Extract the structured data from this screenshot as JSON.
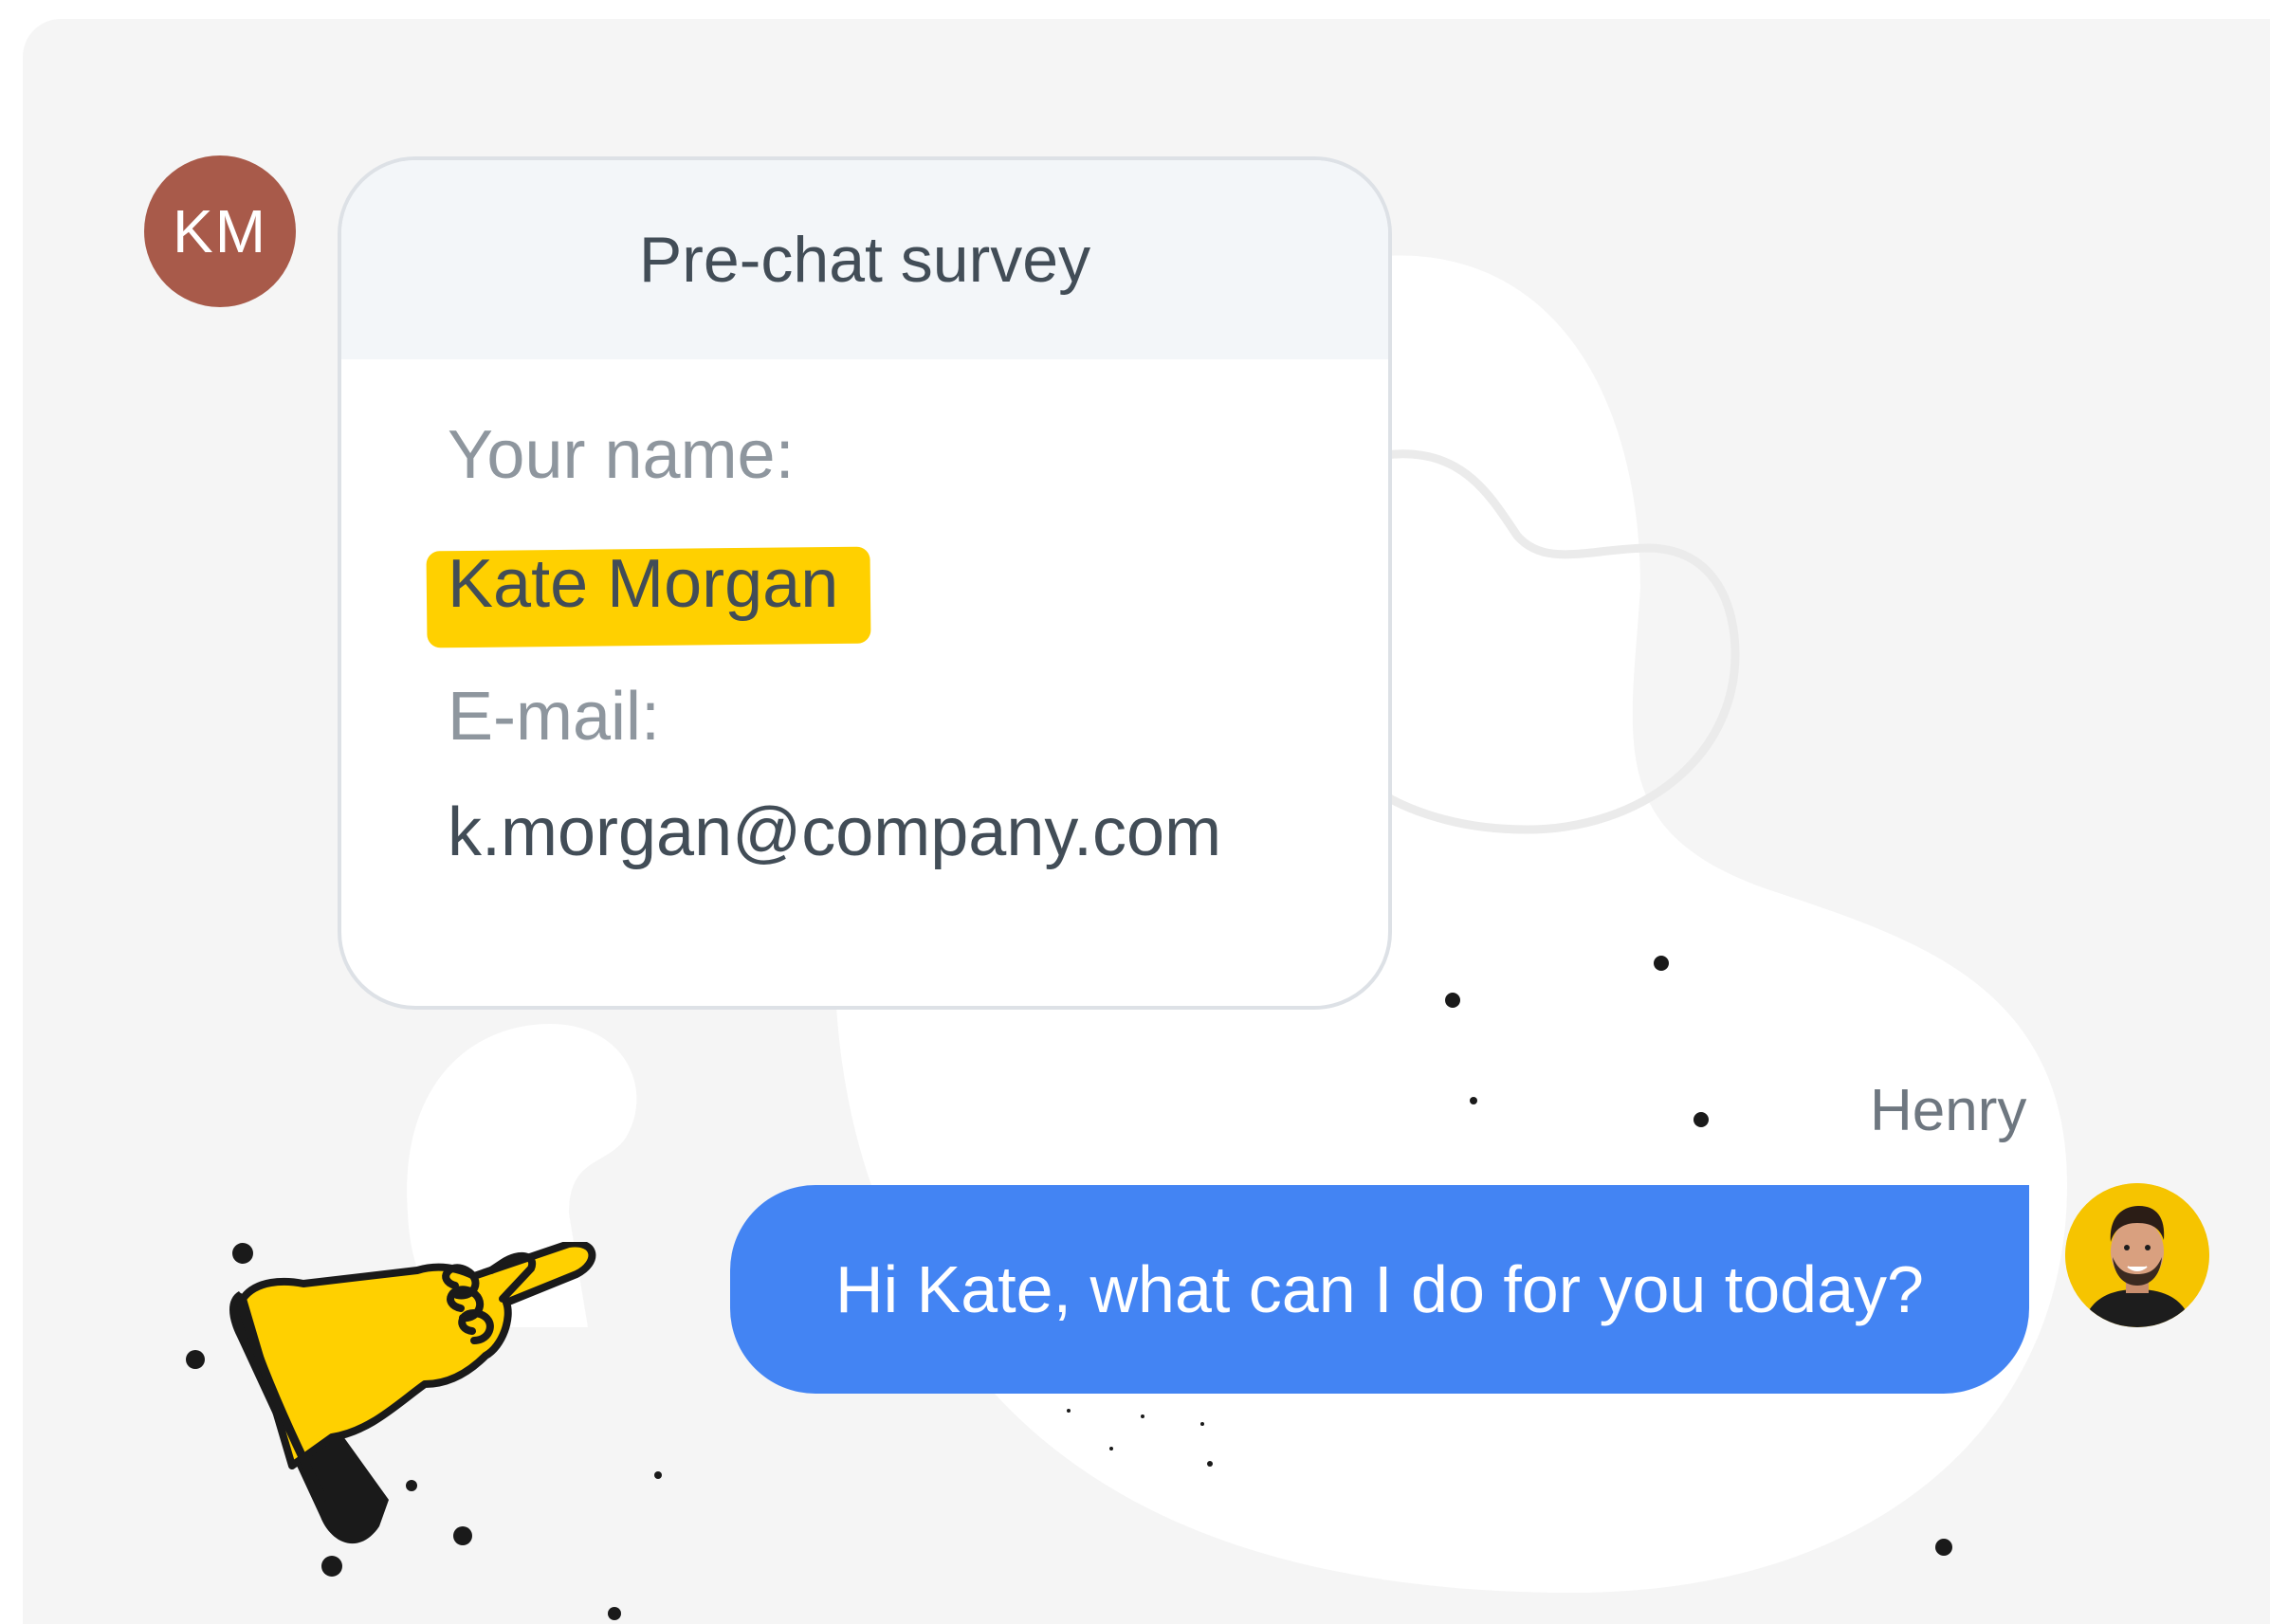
{
  "user": {
    "initials": "KM"
  },
  "survey": {
    "title": "Pre-chat survey",
    "name_label": "Your name:",
    "name_value": "Kate Morgan",
    "email_label": "E-mail:",
    "email_value": "k.morgan@company.com"
  },
  "chat": {
    "agent_name": "Henry",
    "message": "Hi Kate, what can I do for you today?"
  },
  "icons": {
    "pointing_hand": "pointing-hand-icon",
    "agent_avatar": "agent-avatar-icon"
  },
  "colors": {
    "user_avatar_bg": "#a85a4a",
    "bubble_bg": "#4384f3",
    "highlight": "#ffd000",
    "agent_avatar_bg": "#f6c400"
  }
}
